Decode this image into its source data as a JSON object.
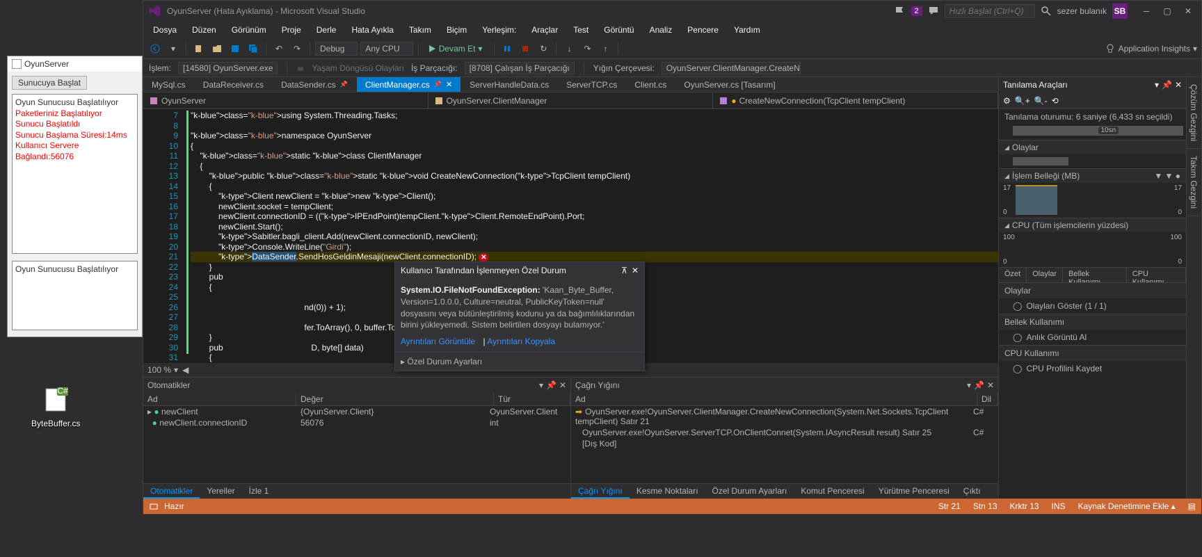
{
  "desktop_file": "ByteBuffer.cs",
  "oyun": {
    "title": "OyunServer",
    "button": "Sunucuya Başlat",
    "log": [
      {
        "t": "Oyun Sunucusu Başlatılıyor",
        "red": false
      },
      {
        "t": "Paketleriniz Başlatılıyor",
        "red": true
      },
      {
        "t": "Sunucu Başlatıldı",
        "red": true
      },
      {
        "t": "Sunucu Başlama Süresi:14ms",
        "red": true
      },
      {
        "t": "Kullanıcı Servere Bağlandı:56076",
        "red": true
      }
    ],
    "box2": "Oyun Sunucusu Başlatılıyor"
  },
  "title": "OyunServer (Hata Ayıklama) - Microsoft Visual Studio",
  "flag_count": "2",
  "quick_launch": "Hızlı Başlat (Ctrl+Q)",
  "user": "sezer bulanık",
  "user_initials": "SB",
  "menu": [
    "Dosya",
    "Düzen",
    "Görünüm",
    "Proje",
    "Derle",
    "Hata Ayıkla",
    "Takım",
    "Biçim",
    "Yerleşim:",
    "Araçlar",
    "Test",
    "Görüntü",
    "Analiz",
    "Pencere",
    "Yardım"
  ],
  "toolbar": {
    "debug": "Debug",
    "anycpu": "Any CPU",
    "continue": "Devam Et",
    "insights": "Application Insights"
  },
  "debug_bar": {
    "process_label": "İşlem:",
    "process": "[14580] OyunServer.exe",
    "lifecycle": "Yaşam Döngüsü Olayları",
    "thread_label": "İş Parçacığı:",
    "thread": "[8708] Çalışan İş Parçacığı",
    "stack_label": "Yığın Çerçevesi:",
    "stack": "OyunServer.ClientManager.CreateNewCon"
  },
  "tabs": [
    "MySql.cs",
    "DataReceiver.cs",
    "DataSender.cs",
    "ClientManager.cs",
    "ServerHandleData.cs",
    "ServerTCP.cs",
    "Client.cs",
    "OyunServer.cs [Tasarım]"
  ],
  "active_tab": 3,
  "nav": {
    "project": "OyunServer",
    "class": "OyunServer.ClientManager",
    "method": "CreateNewConnection(TcpClient tempClient)"
  },
  "code": {
    "start_line": 7,
    "lines": [
      "using System.Threading.Tasks;",
      "",
      "namespace OyunServer",
      "{",
      "    static class ClientManager",
      "    {",
      "        public static void CreateNewConnection(TcpClient tempClient)",
      "        {",
      "            Client newClient = new Client();",
      "            newClient.socket = tempClient;",
      "            newClient.connectionID = ((IPEndPoint)tempClient.Client.RemoteEndPoint).Port;",
      "            newClient.Start();",
      "            Sabitler.bagli_client.Add(newClient.connectionID, newClient);",
      "            Console.WriteLine(\"Girdi\");",
      "            DataSender.SendHosGeldinMesaji(newClient.connectionID);",
      "        }",
      "        pub",
      "        {",
      "        ",
      "                                                 nd(0)) + 1);",
      "        ",
      "                                                 fer.ToArray(), 0, buffer.ToArray().Length, null, null);",
      "        }",
      "        pub                                      D, byte[] data)",
      "        {"
    ],
    "exec_line": 21
  },
  "exception": {
    "title": "Kullanıcı Tarafından İşlenmeyen Özel Durum",
    "bold": "System.IO.FileNotFoundException:",
    "msg": "'Kaan_Byte_Buffer, Version=1.0.0.0, Culture=neutral, PublicKeyToken=null' dosyasını veya bütünleştirilmiş kodunu ya da bağımlılıklarından birini yükleyemedi. Sistem belirtilen dosyayı bulamıyor.'",
    "link1": "Ayrıntıları Görüntüle",
    "link2": "Ayrıntıları Kopyala",
    "footer": "Özel Durum Ayarları"
  },
  "zoom": "100 %",
  "autos": {
    "title": "Otomatikler",
    "cols": [
      "Ad",
      "Değer",
      "Tür"
    ],
    "rows": [
      {
        "name": "newClient",
        "value": "{OyunServer.Client}",
        "type": "OyunServer.Client",
        "expand": true
      },
      {
        "name": "newClient.connectionID",
        "value": "56076",
        "type": "int",
        "expand": false
      }
    ],
    "tabs": [
      "Otomatikler",
      "Yereller",
      "İzle 1"
    ]
  },
  "callstack": {
    "title": "Çağrı Yığını",
    "cols": [
      "Ad",
      "Dil"
    ],
    "rows": [
      {
        "t": "OyunServer.exe!OyunServer.ClientManager.CreateNewConnection(System.Net.Sockets.TcpClient tempClient) Satır 21",
        "lang": "C#",
        "cur": true
      },
      {
        "t": "OyunServer.exe!OyunServer.ServerTCP.OnClientConnet(System.IAsyncResult result) Satır 25",
        "lang": "C#",
        "cur": false
      },
      {
        "t": "[Dış Kod]",
        "lang": "",
        "cur": false
      }
    ],
    "tabs": [
      "Çağrı Yığını",
      "Kesme Noktaları",
      "Özel Durum Ayarları",
      "Komut Penceresi",
      "Yürütme Penceresi",
      "Çıktı"
    ]
  },
  "diag": {
    "title": "Tanılama Araçları",
    "session": "Tanılama oturumu: 6 saniye (6,433 sn seçildi)",
    "ruler": "10sn",
    "events": "Olaylar",
    "memory": "İşlem Belleği (MB)",
    "mem_top": "17",
    "mem_bot": "0",
    "cpu": "CPU (Tüm işlemcilerin yüzdesi)",
    "cpu_top": "100",
    "cpu_bot": "0",
    "tabs": [
      "Özet",
      "Olaylar",
      "Bellek Kullanımı",
      "CPU Kullanımı"
    ],
    "groups": [
      {
        "h": "Olaylar",
        "items": [
          "Olayları Göster (1 / 1)"
        ]
      },
      {
        "h": "Bellek Kullanımı",
        "items": [
          "Anlık Görüntü Al"
        ]
      },
      {
        "h": "CPU Kullanımı",
        "items": [
          "CPU Profilini Kaydet"
        ]
      }
    ],
    "side_tabs": [
      "Çözüm Gezgini",
      "Takım Gezgini"
    ]
  },
  "status": {
    "ready": "Hazır",
    "line": "Str 21",
    "col": "Stn 13",
    "ch": "Krktr 13",
    "ins": "INS",
    "source": "Kaynak Denetimine Ekle"
  },
  "chart_data": [
    {
      "type": "line",
      "title": "İşlem Belleği (MB)",
      "x": [
        0,
        6.4
      ],
      "values": [
        17,
        17
      ],
      "ylim": [
        0,
        17
      ],
      "xlabel": "s",
      "ylabel": "MB"
    },
    {
      "type": "line",
      "title": "CPU (Tüm işlemcilerin yüzdesi)",
      "x": [
        0,
        6.4
      ],
      "values": [
        5,
        3
      ],
      "ylim": [
        0,
        100
      ],
      "xlabel": "s",
      "ylabel": "%"
    }
  ]
}
